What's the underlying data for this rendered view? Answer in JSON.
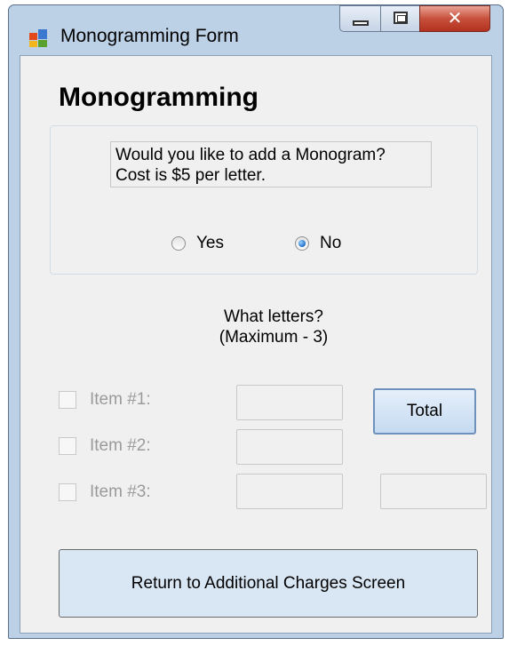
{
  "window": {
    "title": "Monogramming Form",
    "icon": "windows-form-icon",
    "controls": {
      "minimize": "minimize-icon",
      "maximize": "maximize-icon",
      "close": "close-icon"
    }
  },
  "form": {
    "heading": "Monogramming",
    "question_line1": "Would you like to add a Monogram?",
    "question_line2": "Cost is $5 per letter.",
    "radios": [
      {
        "label": "Yes",
        "checked": false
      },
      {
        "label": "No",
        "checked": true
      }
    ],
    "letters_prompt_line1": "What letters?",
    "letters_prompt_line2": "(Maximum - 3)",
    "items": [
      {
        "label": "Item #1:",
        "value": "",
        "checked": false,
        "enabled": false
      },
      {
        "label": "Item #2:",
        "value": "",
        "checked": false,
        "enabled": false
      },
      {
        "label": "Item #3:",
        "value": "",
        "checked": false,
        "enabled": false
      }
    ],
    "total_button": "Total",
    "total_value": "",
    "return_button": "Return to Additional Charges Screen"
  },
  "colors": {
    "window_frame": "#bcd0e6",
    "client_bg": "#f0f0f0",
    "close_button": "#c7503c",
    "button_bg": "#d9e6f4",
    "disabled_text": "#9b9b9b"
  }
}
